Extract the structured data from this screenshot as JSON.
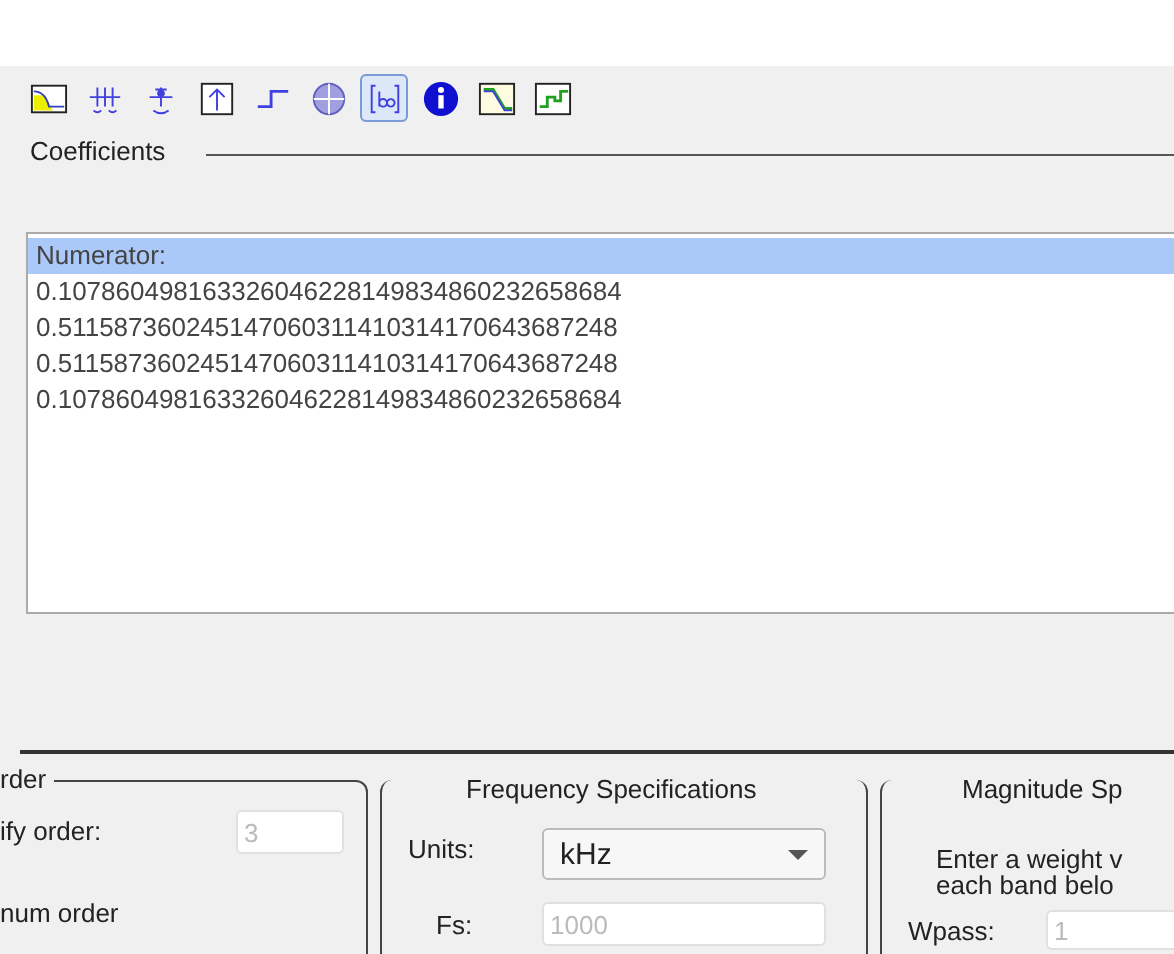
{
  "toolbar": {
    "buttons": [
      {
        "selected": false
      },
      {
        "selected": false
      },
      {
        "selected": false
      },
      {
        "selected": false
      },
      {
        "selected": false
      },
      {
        "selected": false
      },
      {
        "selected": true
      },
      {
        "selected": false
      },
      {
        "selected": false
      },
      {
        "selected": false
      }
    ]
  },
  "coefficients": {
    "title": "Coefficients",
    "rows": [
      {
        "text": "Numerator:",
        "selected": true
      },
      {
        "text": "0.107860498163326046228149834860232658684",
        "selected": false
      },
      {
        "text": "0.511587360245147060311410314170643687248",
        "selected": false
      },
      {
        "text": "0.511587360245147060311410314170643687248",
        "selected": false
      },
      {
        "text": "0.107860498163326046228149834860232658684",
        "selected": false
      }
    ]
  },
  "order": {
    "title": "rder",
    "specify_label": "ify order:",
    "order_value": "3",
    "order_disabled": true,
    "minimum_label": "num order"
  },
  "frequency": {
    "title": "Frequency Specifications",
    "units_label": "Units:",
    "units_value": "kHz",
    "fs_label": "Fs:",
    "fs_value": "1000",
    "fs_disabled": true
  },
  "magnitude": {
    "title": "Magnitude Sp",
    "instructions": [
      "Enter a weight v",
      "each band belo"
    ],
    "wpass_label": "Wpass:",
    "wpass_value": "1",
    "wpass_disabled": true
  }
}
